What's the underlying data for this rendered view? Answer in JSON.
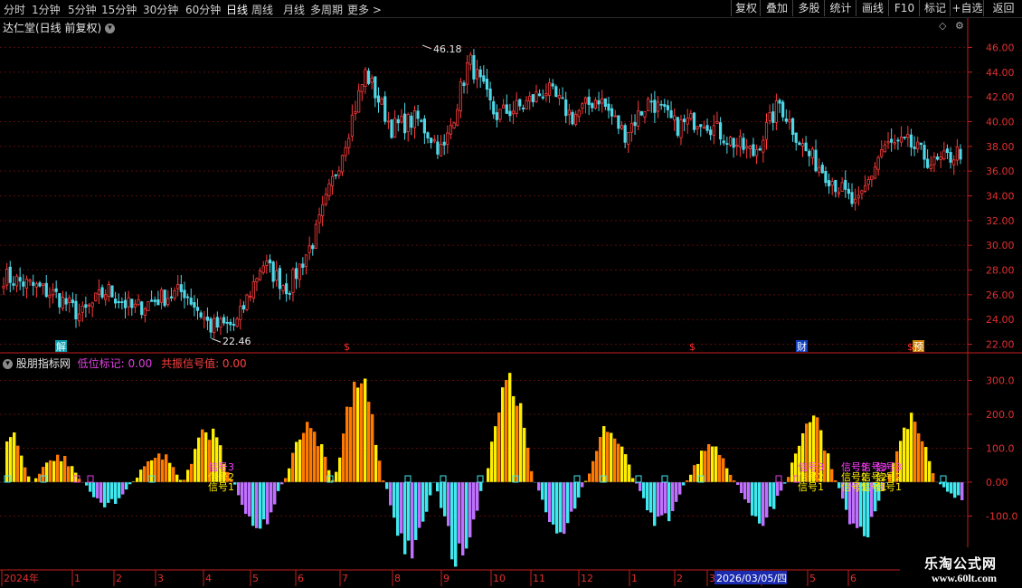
{
  "toolbar": {
    "periods": [
      "分时",
      "1分钟",
      "5分钟",
      "15分钟",
      "30分钟",
      "60分钟",
      "日线",
      "周线",
      "月线",
      "多周期",
      "更多 >"
    ],
    "active_period": "日线",
    "buttons": [
      "复权",
      "叠加",
      "多股",
      "统计",
      "画线",
      "F10",
      "标记",
      "+自选",
      "返回"
    ]
  },
  "main_panel": {
    "title": "达仁堂(日线 前复权)",
    "high_label": "46.18",
    "low_label": "22.46",
    "event_marks": [
      "解",
      "$",
      "$",
      "财",
      "$",
      "预"
    ],
    "colors": {
      "up": "#ff3b3b",
      "down": "#4fd8e8",
      "axis": "#c81e1e"
    }
  },
  "indicator_panel": {
    "name": "股朋指标网",
    "label1": "低位标记: 0.00",
    "label2": "共振信号值: 0.00",
    "signals": [
      "信号3",
      "信号2",
      "信号1"
    ],
    "colors": {
      "label1": "#e040e0",
      "label2": "#ff4040",
      "orange": "#ff7a00",
      "yellow": "#ffee00",
      "cyan": "#40e8f0",
      "violet": "#c070ff"
    }
  },
  "chart_data": [
    {
      "type": "candlestick",
      "title": "达仁堂(日线 前复权)",
      "y_ticks": [
        "46.00",
        "44.00",
        "42.00",
        "40.00",
        "38.00",
        "36.00",
        "34.00",
        "32.00",
        "30.00",
        "28.00",
        "26.00",
        "24.00",
        "22.00"
      ],
      "ylim": [
        21.6,
        47.2
      ],
      "annotations": {
        "high": 46.18,
        "low": 22.46
      },
      "x": [
        "2024年",
        "1",
        "2",
        "3",
        "4",
        "5",
        "6",
        "7",
        "8",
        "9",
        "10",
        "11",
        "12",
        "1",
        "2",
        "3",
        "4",
        "5",
        "6"
      ],
      "close": [
        27.5,
        26.8,
        26.0,
        24.3,
        26.4,
        24.8,
        25.7,
        26.3,
        23.4,
        23.6,
        28.6,
        26.5,
        30.5,
        37.0,
        44.0,
        39.5,
        40.2,
        37.5,
        45.0,
        40.5,
        41.2,
        42.6,
        40.4,
        42.0,
        39.0,
        41.8,
        39.6,
        40.3,
        38.6,
        37.4,
        41.5,
        37.6,
        35.4,
        33.0,
        38.0,
        38.2,
        36.5,
        37.6
      ]
    },
    {
      "type": "bar",
      "title": "股朋指标网",
      "y_ticks": [
        "300.0",
        "200.0",
        "100.0",
        "0.00",
        "-100.0"
      ],
      "ylim": [
        -240,
        330
      ],
      "peaks": [
        160,
        85,
        -70,
        90,
        160,
        -150,
        180,
        325,
        -220,
        -240,
        330,
        -160,
        175,
        -130,
        110,
        -120,
        200,
        -170,
        200,
        -50
      ]
    }
  ],
  "bottom_bar": {
    "months": [
      "2024年",
      "1",
      "2",
      "3",
      "4",
      "5",
      "6",
      "7",
      "8",
      "9",
      "10",
      "11",
      "12",
      "1",
      "2",
      "3",
      "4",
      "5",
      "6"
    ],
    "cursor_date": "2026/03/05/四"
  },
  "watermark": {
    "line1": "乐淘公式网",
    "line2": "www.60lt.com"
  }
}
